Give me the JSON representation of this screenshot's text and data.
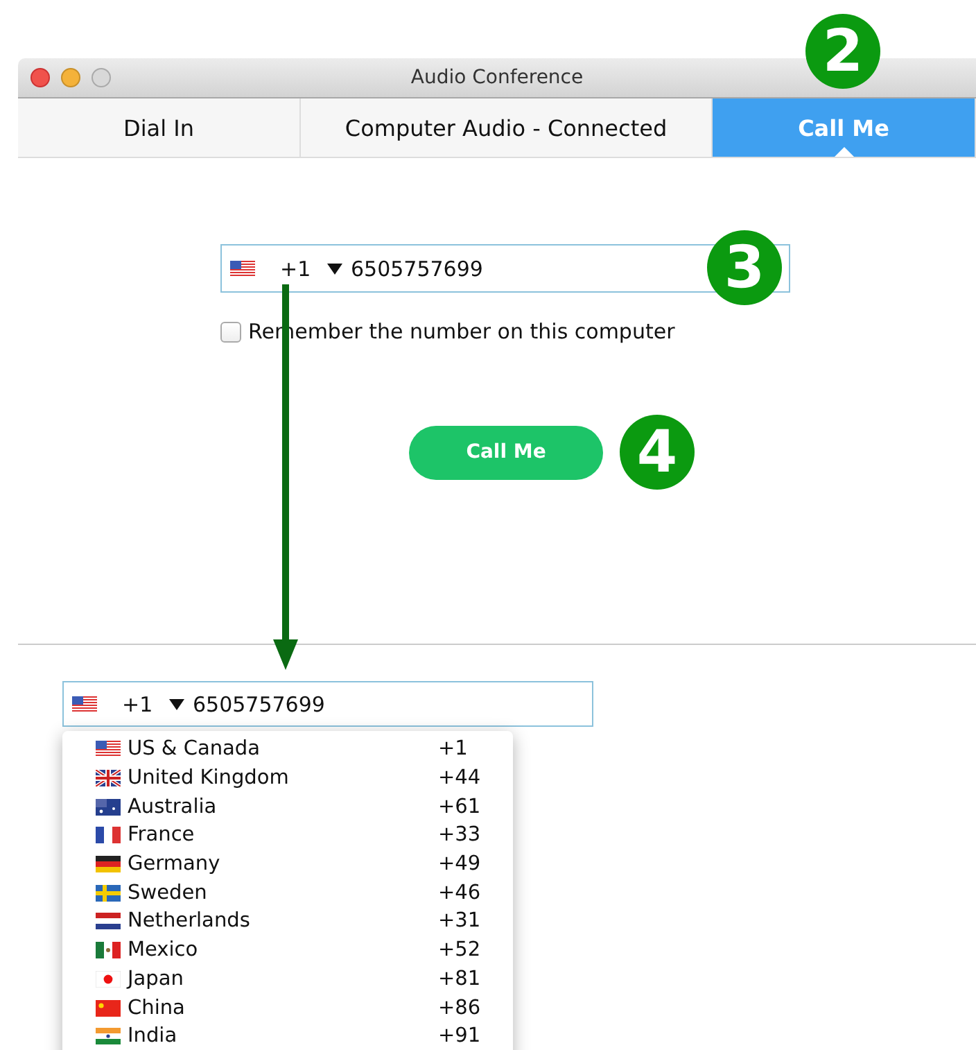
{
  "window": {
    "title": "Audio Conference"
  },
  "tabs": [
    {
      "label": "Dial In",
      "selected": false
    },
    {
      "label": "Computer Audio - Connected",
      "selected": false
    },
    {
      "label": "Call Me",
      "selected": true
    }
  ],
  "phone_field": {
    "country_code": "+1",
    "value": "6505757699"
  },
  "remember_checkbox": {
    "label": "Remember the number on this computer",
    "checked": false
  },
  "call_button": {
    "label": "Call Me"
  },
  "step_markers": [
    "2",
    "3",
    "4"
  ],
  "expanded_view": {
    "phone_field": {
      "country_code": "+1",
      "value": "6505757699"
    },
    "country_list": [
      {
        "name": "US & Canada",
        "code": "+1"
      },
      {
        "name": "United Kingdom",
        "code": "+44"
      },
      {
        "name": "Australia",
        "code": "+61"
      },
      {
        "name": "France",
        "code": "+33"
      },
      {
        "name": "Germany",
        "code": "+49"
      },
      {
        "name": "Sweden",
        "code": "+46"
      },
      {
        "name": "Netherlands",
        "code": "+31"
      },
      {
        "name": "Mexico",
        "code": "+52"
      },
      {
        "name": "Japan",
        "code": "+81"
      },
      {
        "name": "China",
        "code": "+86"
      },
      {
        "name": "India",
        "code": "+91"
      }
    ]
  }
}
